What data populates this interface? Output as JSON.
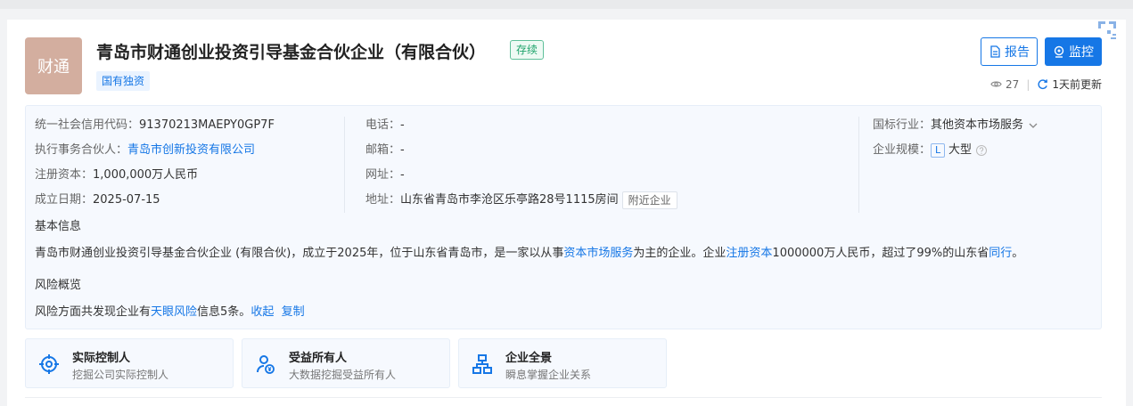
{
  "company": {
    "logo_text": "财通",
    "name": "青岛市财通创业投资引导基金合伙企业（有限合伙）",
    "status": "存续",
    "tag": "国有独资"
  },
  "actions": {
    "report_label": "报告",
    "monitor_label": "监控",
    "views": "27",
    "updated": "1天前更新"
  },
  "info": {
    "col1": [
      {
        "label": "统一社会信用代码：",
        "value": "91370213MAEPY0GP7F"
      },
      {
        "label": "执行事务合伙人：",
        "value": "青岛市创新投资有限公司"
      },
      {
        "label": "注册资本：",
        "value": "1,000,000万人民币"
      },
      {
        "label": "成立日期：",
        "value": "2025-07-15"
      }
    ],
    "col2": [
      {
        "label": "电话：",
        "value": "-"
      },
      {
        "label": "邮箱：",
        "value": "-"
      },
      {
        "label": "网址：",
        "value": "-"
      },
      {
        "label": "地址：",
        "value": "山东省青岛市李沧区乐亭路28号1115房间",
        "extra": "附近企业"
      }
    ],
    "col3": [
      {
        "label": "国标行业：",
        "value": "其他资本市场服务"
      },
      {
        "label": "企业规模：",
        "badge": "L",
        "value": "大型"
      }
    ]
  },
  "basic": {
    "title": "基本信息",
    "p1": "青岛市财通创业投资引导基金合伙企业 (有限合伙)，成立于2025年，位于山东省青岛市，是一家以从事",
    "l1": "资本市场服务",
    "p2": "为主的企业。企业",
    "l2": "注册资本",
    "p3": "1000000万人民币，超过了99%的山东省",
    "l3": "同行",
    "p4": "。"
  },
  "risk": {
    "title": "风险概览",
    "p1": "风险方面共发现企业有",
    "l1": "天眼风险",
    "p2": "信息5条。",
    "collapse": "收起",
    "copy": "复制"
  },
  "features": [
    {
      "title": "实际控制人",
      "sub": "挖掘公司实际控制人"
    },
    {
      "title": "受益所有人",
      "sub": "大数据挖掘受益所有人"
    },
    {
      "title": "企业全景",
      "sub": "瞬息掌握企业关系"
    }
  ],
  "colors": {
    "accent": "#1677e6",
    "status": "#1ea36b",
    "logo_bg": "#d3ae9f"
  }
}
